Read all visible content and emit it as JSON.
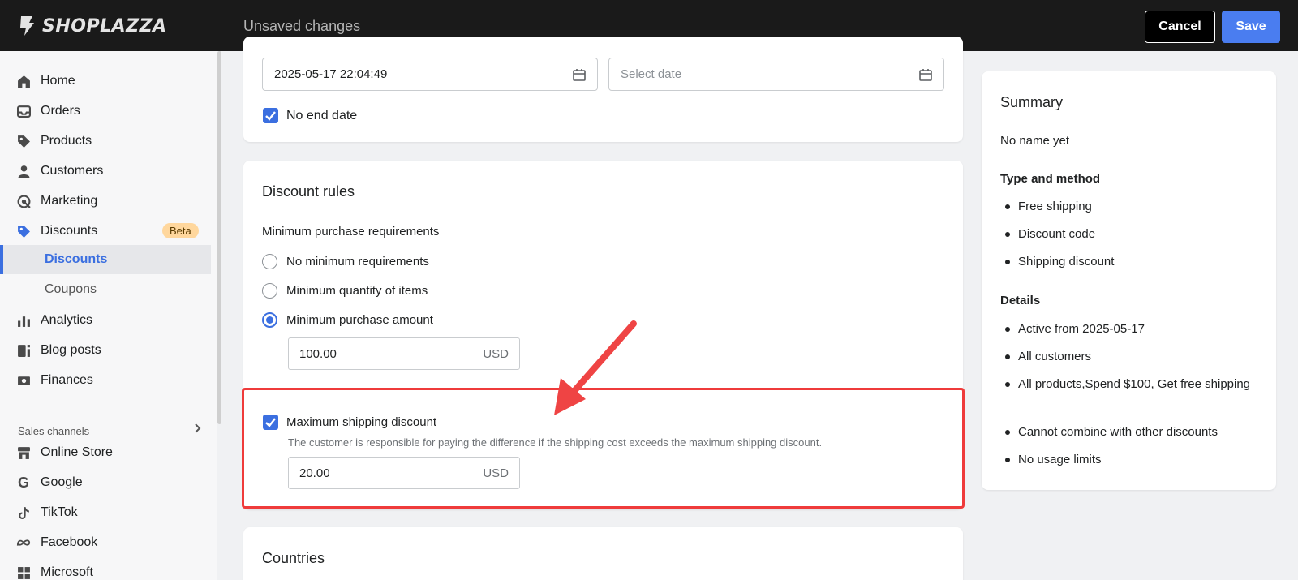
{
  "topbar": {
    "brand": "SHOPLAZZA",
    "status": "Unsaved changes",
    "cancel_label": "Cancel",
    "save_label": "Save"
  },
  "sidebar": {
    "items": [
      {
        "label": "Home",
        "icon": "home-icon"
      },
      {
        "label": "Orders",
        "icon": "inbox-icon"
      },
      {
        "label": "Products",
        "icon": "tag-icon"
      },
      {
        "label": "Customers",
        "icon": "person-icon"
      },
      {
        "label": "Marketing",
        "icon": "target-icon"
      },
      {
        "label": "Discounts",
        "icon": "discount-tag-icon",
        "badge": "Beta"
      },
      {
        "label": "Analytics",
        "icon": "bar-chart-icon"
      },
      {
        "label": "Blog posts",
        "icon": "blog-icon"
      },
      {
        "label": "Finances",
        "icon": "finance-icon"
      }
    ],
    "subitems": [
      {
        "label": "Discounts",
        "active": true
      },
      {
        "label": "Coupons",
        "active": false
      }
    ],
    "sales_channels_label": "Sales channels",
    "channels": [
      {
        "label": "Online Store",
        "icon": "store-icon"
      },
      {
        "label": "Google",
        "icon": "google-icon"
      },
      {
        "label": "TikTok",
        "icon": "tiktok-icon"
      },
      {
        "label": "Facebook",
        "icon": "meta-icon"
      },
      {
        "label": "Microsoft",
        "icon": "microsoft-icon"
      }
    ]
  },
  "dates": {
    "start_value": "2025-05-17 22:04:49",
    "end_placeholder": "Select date",
    "no_end_label": "No end date",
    "no_end_checked": true
  },
  "rules": {
    "title": "Discount rules",
    "min_label": "Minimum purchase requirements",
    "options": [
      "No minimum requirements",
      "Minimum quantity of items",
      "Minimum purchase amount"
    ],
    "selected": 2,
    "amount_value": "100.00",
    "currency": "USD",
    "max_label": "Maximum shipping discount",
    "max_checked": true,
    "max_help": "The customer is responsible for paying the difference if the shipping cost exceeds the maximum shipping discount.",
    "max_value": "20.00"
  },
  "countries": {
    "title": "Countries"
  },
  "summary": {
    "title": "Summary",
    "name": "No name yet",
    "type_heading": "Type and method",
    "type_items": [
      "Free shipping",
      "Discount code",
      "Shipping discount"
    ],
    "details_heading": "Details",
    "details_items": [
      "Active from 2025-05-17",
      "All customers",
      "All products,Spend $100, Get free shipping",
      "Cannot combine with other discounts",
      "No usage limits"
    ]
  },
  "colors": {
    "accent": "#3b6fe0",
    "save": "#4a7df0",
    "highlight": "#ef3b3b",
    "topbar": "#1a1a1a"
  }
}
